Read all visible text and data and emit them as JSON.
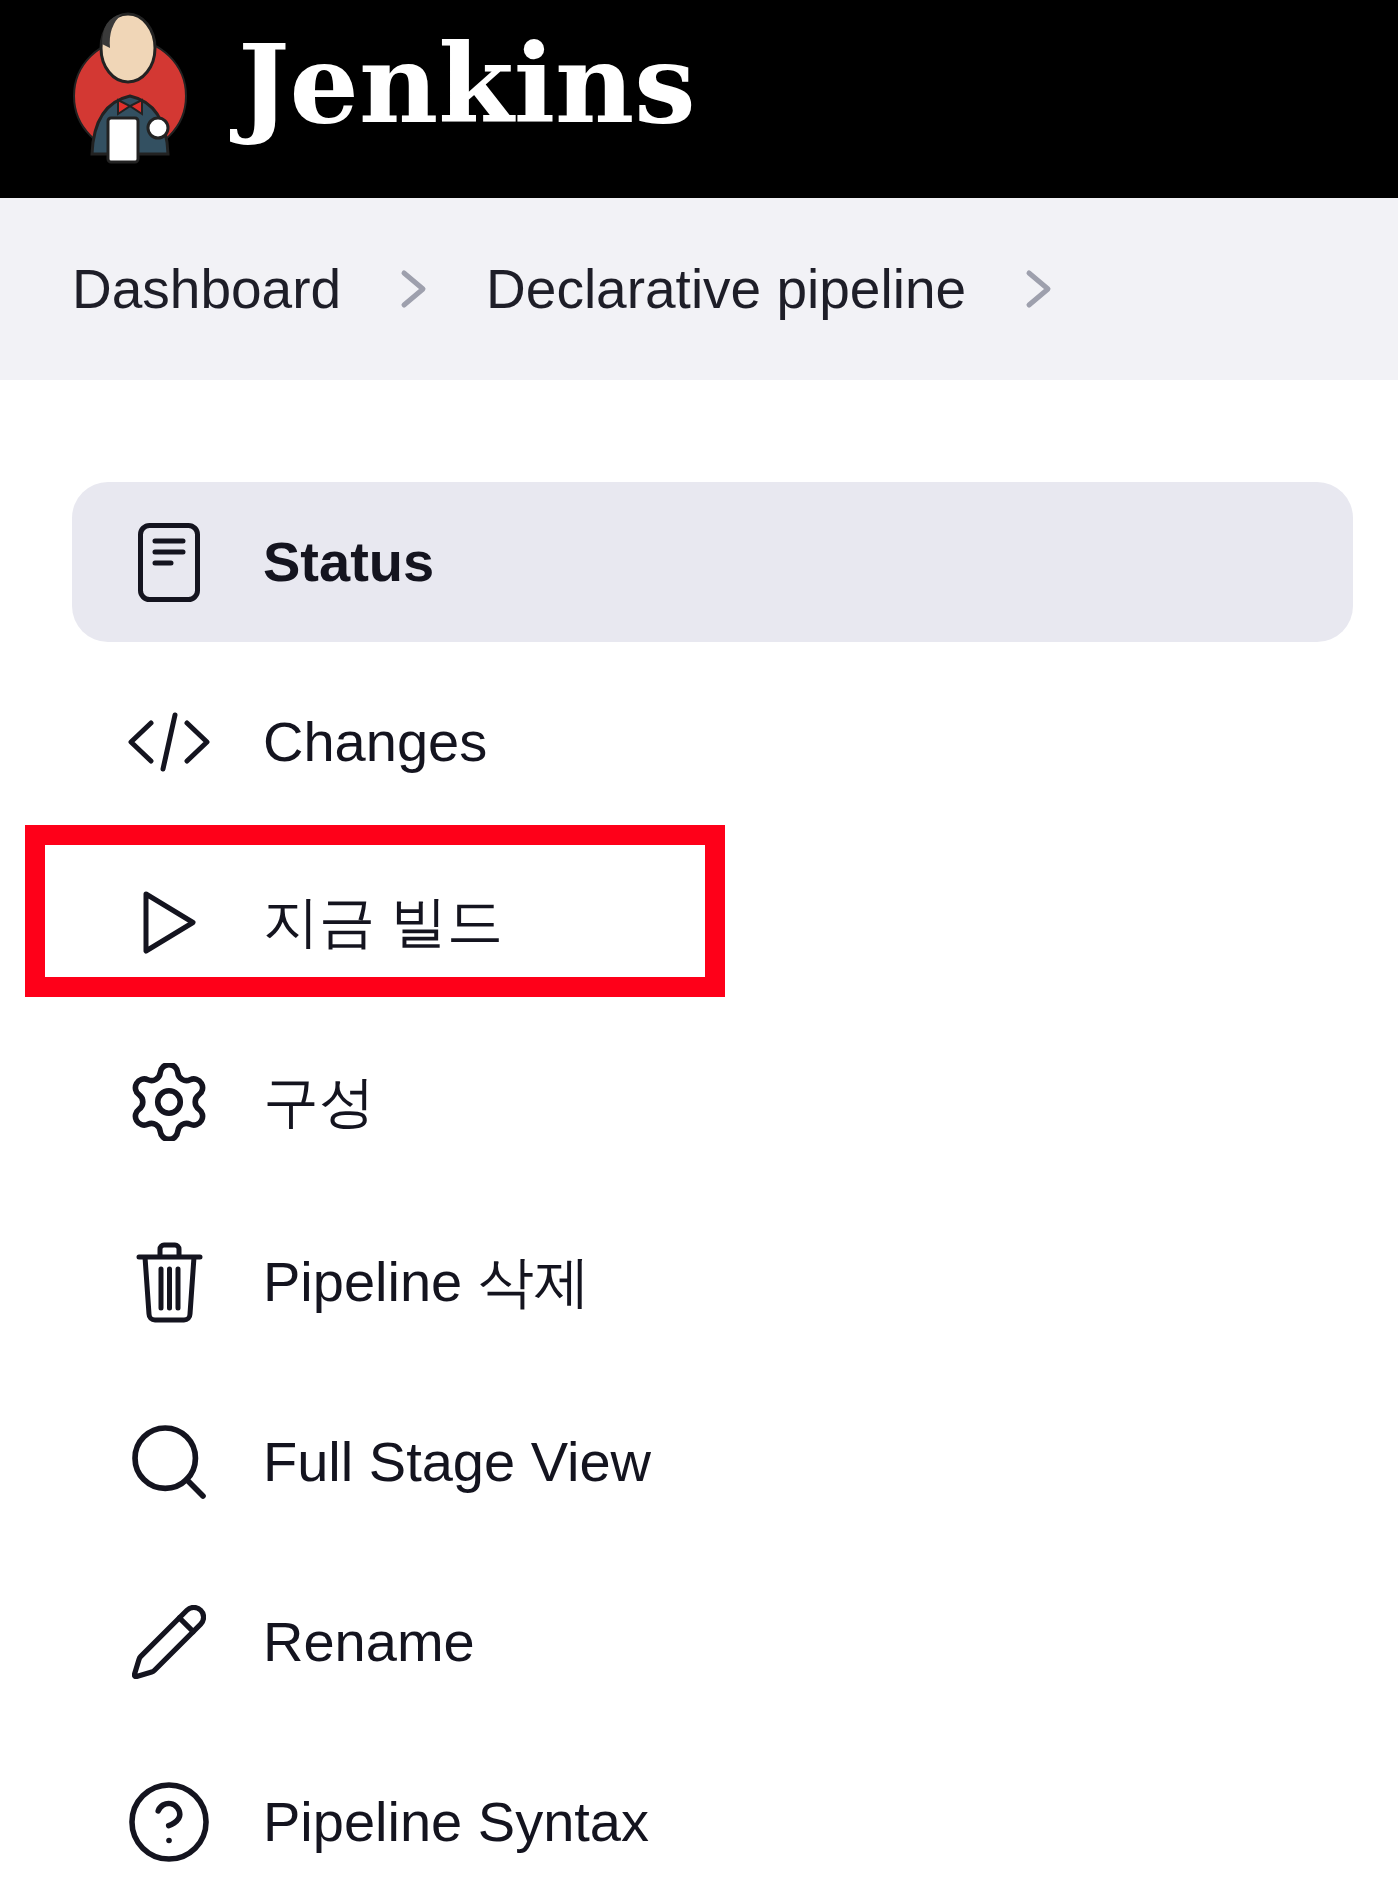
{
  "header": {
    "title": "Jenkins"
  },
  "breadcrumbs": [
    {
      "label": "Dashboard"
    },
    {
      "label": "Declarative pipeline"
    }
  ],
  "menu": [
    {
      "label": "Status",
      "selected": true,
      "highlighted": false
    },
    {
      "label": "Changes",
      "selected": false,
      "highlighted": false
    },
    {
      "label": "지금 빌드",
      "selected": false,
      "highlighted": true
    },
    {
      "label": "구성",
      "selected": false,
      "highlighted": false
    },
    {
      "label": "Pipeline 삭제",
      "selected": false,
      "highlighted": false
    },
    {
      "label": "Full Stage View",
      "selected": false,
      "highlighted": false
    },
    {
      "label": "Rename",
      "selected": false,
      "highlighted": false
    },
    {
      "label": "Pipeline Syntax",
      "selected": false,
      "highlighted": false
    }
  ]
}
